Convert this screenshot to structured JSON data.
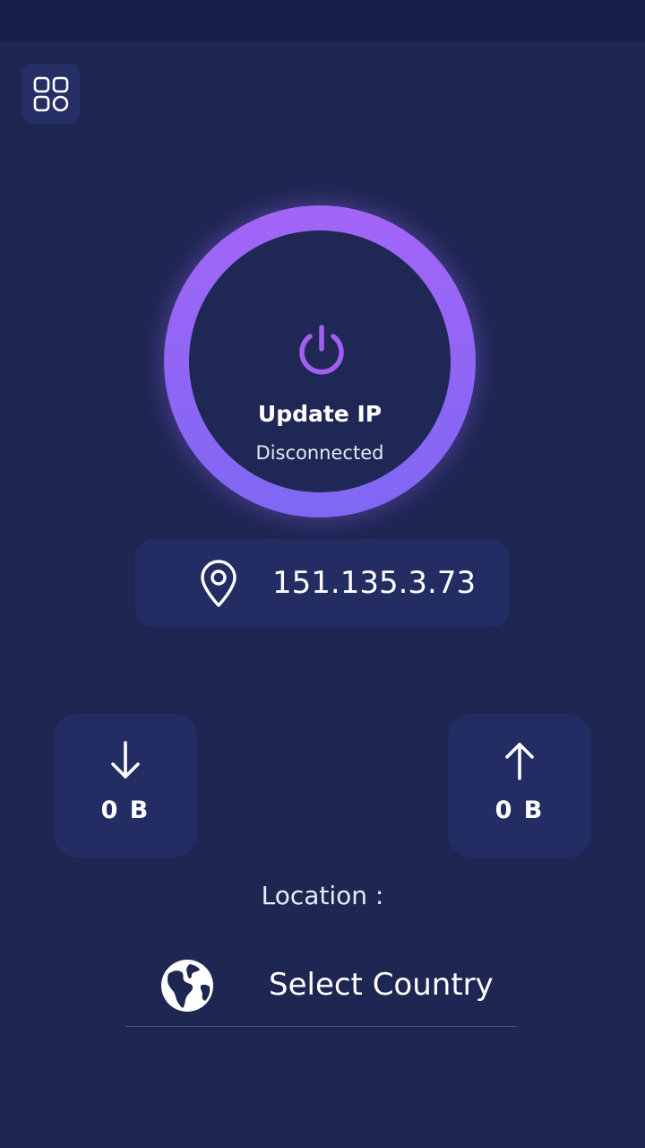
{
  "connect": {
    "title": "Update IP",
    "status": "Disconnected"
  },
  "ip": {
    "address": "151.135.3.73"
  },
  "traffic": {
    "download": "0 B",
    "upload": "0 B"
  },
  "location": {
    "label": "Location :",
    "country_placeholder": "Select Country"
  },
  "icons": {
    "menu": "grid-icon",
    "power": "power-icon",
    "pin": "map-pin-icon",
    "download": "arrow-down-icon",
    "upload": "arrow-up-icon",
    "globe": "globe-icon"
  },
  "colors": {
    "background": "#1e2652",
    "card": "#232c63",
    "accent": "#9b66f6"
  }
}
